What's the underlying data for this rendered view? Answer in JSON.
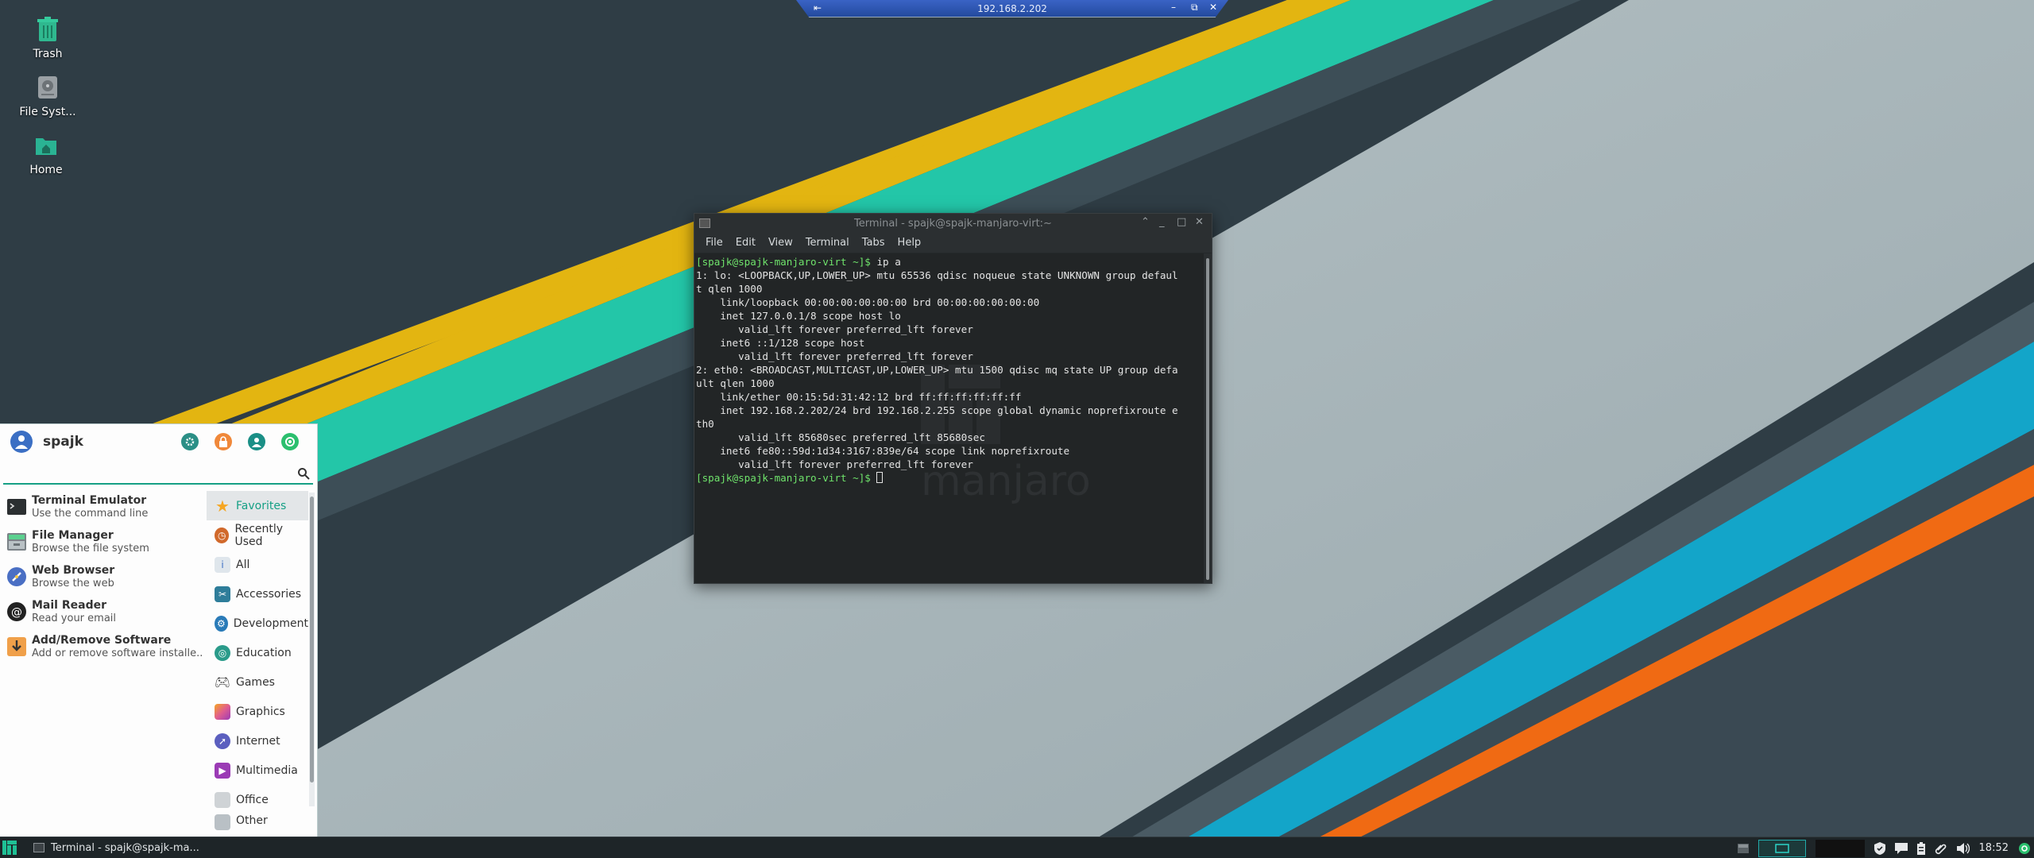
{
  "remote_bar": {
    "ip": "192.168.2.202"
  },
  "desktop": {
    "icons": [
      {
        "label": "Trash",
        "icon": "trash-icon"
      },
      {
        "label": "File Syst...",
        "icon": "drive-icon"
      },
      {
        "label": "Home",
        "icon": "home-folder-icon"
      }
    ]
  },
  "terminal": {
    "title": "Terminal - spajk@spajk-manjaro-virt:~",
    "menu": [
      "File",
      "Edit",
      "View",
      "Terminal",
      "Tabs",
      "Help"
    ],
    "prompt1": "[spajk@spajk-manjaro-virt ~]$",
    "cmd1": " ip a",
    "output": "1: lo: <LOOPBACK,UP,LOWER_UP> mtu 65536 qdisc noqueue state UNKNOWN group defaul\nt qlen 1000\n    link/loopback 00:00:00:00:00:00 brd 00:00:00:00:00:00\n    inet 127.0.0.1/8 scope host lo\n       valid_lft forever preferred_lft forever\n    inet6 ::1/128 scope host\n       valid_lft forever preferred_lft forever\n2: eth0: <BROADCAST,MULTICAST,UP,LOWER_UP> mtu 1500 qdisc mq state UP group defa\nult qlen 1000\n    link/ether 00:15:5d:31:42:12 brd ff:ff:ff:ff:ff:ff\n    inet 192.168.2.202/24 brd 192.168.2.255 scope global dynamic noprefixroute e\nth0\n       valid_lft 85680sec preferred_lft 85680sec\n    inet6 fe80::59d:1d34:3167:839e/64 scope link noprefixroute\n       valid_lft forever preferred_lft forever",
    "prompt2": "[spajk@spajk-manjaro-virt ~]$",
    "logo_text": "manjaro"
  },
  "menu": {
    "username": "spajk",
    "search_placeholder": "",
    "apps": [
      {
        "name": "Terminal Emulator",
        "desc": "Use the command line",
        "icon": "terminal-icon"
      },
      {
        "name": "File Manager",
        "desc": "Browse the file system",
        "icon": "file-manager-icon"
      },
      {
        "name": "Web Browser",
        "desc": "Browse the web",
        "icon": "web-browser-icon"
      },
      {
        "name": "Mail Reader",
        "desc": "Read your email",
        "icon": "mail-icon"
      },
      {
        "name": "Add/Remove Software",
        "desc": "Add or remove software installe...",
        "icon": "software-install-icon"
      }
    ],
    "categories": [
      {
        "label": "Favorites",
        "icon": "star-icon",
        "color": "#f5a623",
        "selected": true
      },
      {
        "label": "Recently Used",
        "icon": "clock-icon",
        "color": "#d1692b"
      },
      {
        "label": "All",
        "icon": "all-apps-icon",
        "color": "#8fa2b3"
      },
      {
        "label": "Accessories",
        "icon": "accessories-icon",
        "color": "#2e7d9a"
      },
      {
        "label": "Development",
        "icon": "development-icon",
        "color": "#2a7bb8"
      },
      {
        "label": "Education",
        "icon": "education-icon",
        "color": "#2a9b8a"
      },
      {
        "label": "Games",
        "icon": "gamepad-icon",
        "color": "#333333"
      },
      {
        "label": "Graphics",
        "icon": "graphics-icon",
        "color": "#e05d8e"
      },
      {
        "label": "Internet",
        "icon": "internet-icon",
        "color": "#5b5fbf"
      },
      {
        "label": "Multimedia",
        "icon": "multimedia-icon",
        "color": "#9b3bb5"
      },
      {
        "label": "Office",
        "icon": "office-icon",
        "color": "#cfd3d6"
      },
      {
        "label": "Other",
        "icon": "other-icon",
        "color": "#b9c0c5"
      }
    ]
  },
  "panel": {
    "task_label": "Terminal - spajk@spajk-ma...",
    "clock": "18:52"
  },
  "colors": {
    "accent": "#16a085",
    "terminal_prompt": "#6fe36b",
    "panel_bg": "#1e2528"
  }
}
